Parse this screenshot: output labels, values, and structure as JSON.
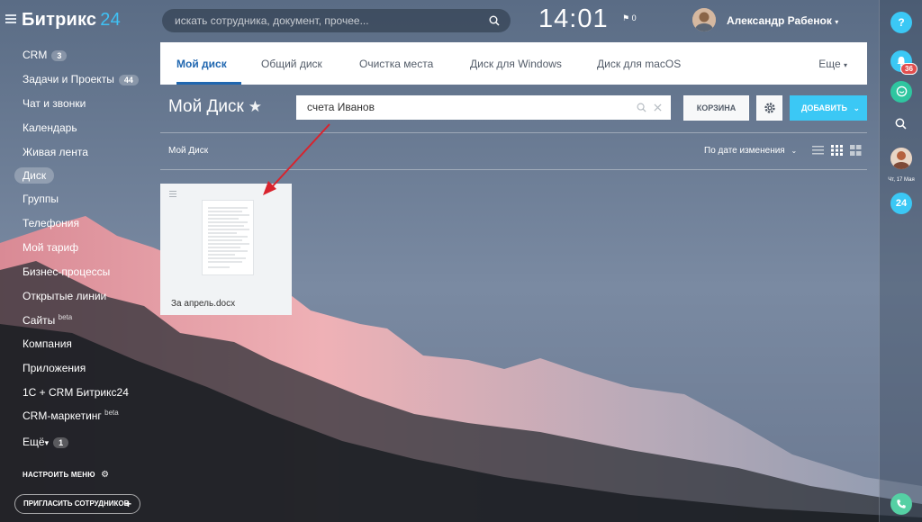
{
  "topbar": {
    "logo_main": "Битрикс",
    "logo_num": "24",
    "search_placeholder": "искать сотрудника, документ, прочее...",
    "clock": "14:01",
    "flag_count": "0",
    "user_name": "Александр Рабенок"
  },
  "menu": {
    "items": [
      {
        "label": "CRM",
        "badge": "3"
      },
      {
        "label": "Задачи и Проекты",
        "badge": "44"
      },
      {
        "label": "Чат и звонки"
      },
      {
        "label": "Календарь"
      },
      {
        "label": "Живая лента"
      },
      {
        "label": "Диск"
      },
      {
        "label": "Группы"
      },
      {
        "label": "Телефония"
      },
      {
        "label": "Мой тариф"
      },
      {
        "label": "Бизнес-процессы"
      },
      {
        "label": "Открытые линии"
      },
      {
        "label": "Сайты",
        "sup": "beta"
      },
      {
        "label": "Компания"
      },
      {
        "label": "Приложения"
      },
      {
        "label": "1С + CRM Битрикс24"
      },
      {
        "label": "CRM-маркетинг",
        "sup": "beta"
      },
      {
        "label": "Ещё",
        "badge": "1"
      }
    ],
    "configure": "НАСТРОИТЬ МЕНЮ",
    "invite": "ПРИГЛАСИТЬ СОТРУДНИКОВ"
  },
  "tabs": {
    "items": [
      "Мой диск",
      "Общий диск",
      "Очистка места",
      "Диск для Windows",
      "Диск для macOS"
    ],
    "more": "Еще"
  },
  "disk": {
    "title": "Мой Диск",
    "search_value": "счета Иванов",
    "trash": "КОРЗИНА",
    "add": "ДОБАВИТЬ",
    "breadcrumb": "Мой Диск",
    "sort": "По дате изменения",
    "file_name": "За апрель.docx"
  },
  "rightbar": {
    "help": "?",
    "bell_count": "36",
    "date": "Чт, 17 Мая",
    "b24": "24"
  },
  "colors": {
    "accent_blue": "#2067b0",
    "add_button": "#3bc8f5",
    "logo_num": "#3fc1f4",
    "badge_red": "#e14e4e",
    "phone_green": "#55d0a4",
    "arrow_red": "#d9232d"
  }
}
